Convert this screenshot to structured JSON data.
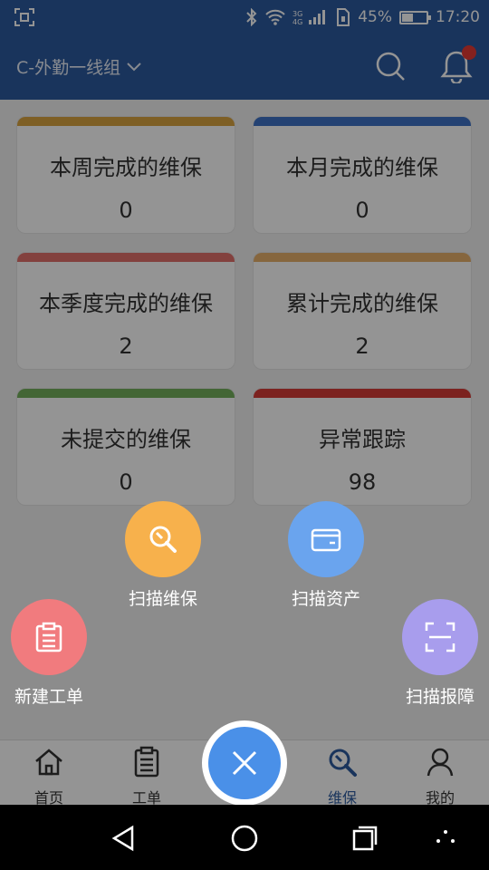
{
  "status": {
    "battery": "45%",
    "time": "17:20",
    "battery_level": 0.45
  },
  "header": {
    "group": "C-外勤一线组"
  },
  "cards": [
    {
      "title": "本周完成的维保",
      "value": "0",
      "color": "#d9a441"
    },
    {
      "title": "本月完成的维保",
      "value": "0",
      "color": "#3f72c6"
    },
    {
      "title": "本季度完成的维保",
      "value": "2",
      "color": "#e2706b"
    },
    {
      "title": "累计完成的维保",
      "value": "2",
      "color": "#e7b06c"
    },
    {
      "title": "未提交的维保",
      "value": "0",
      "color": "#74b05c"
    },
    {
      "title": "异常跟踪",
      "value": "98",
      "color": "#d63b36"
    }
  ],
  "fab": {
    "scan_maintenance": "扫描维保",
    "scan_asset": "扫描资产",
    "new_work_order": "新建工单",
    "scan_fault": "扫描报障"
  },
  "tabs": [
    {
      "label": "首页"
    },
    {
      "label": "工单"
    },
    {
      "label": "维保"
    },
    {
      "label": "我的"
    }
  ]
}
